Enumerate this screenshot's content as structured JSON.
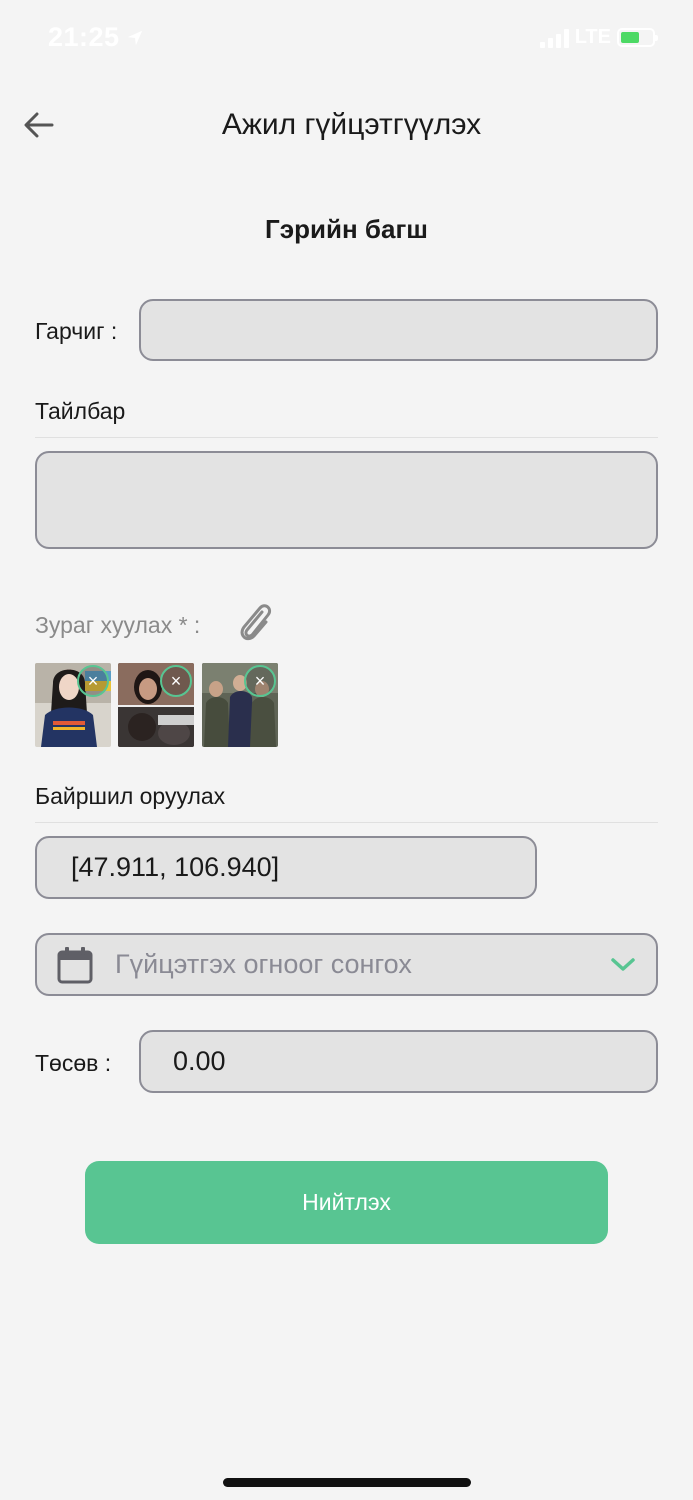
{
  "status_bar": {
    "time": "21:25",
    "network": "LTE"
  },
  "header": {
    "title": "Ажил гүйцэтгүүлэх"
  },
  "job_type": "Гэрийн багш",
  "form": {
    "title_label": "Гарчиг :",
    "title_value": "",
    "description_label": "Тайлбар",
    "description_value": "",
    "photo_label": "Зураг хуулах * :",
    "photos": [
      {
        "close_symbol": "×"
      },
      {
        "close_symbol": "×"
      },
      {
        "close_symbol": "×"
      }
    ],
    "location_label": "Байршил оруулах",
    "location_value": "[47.911, 106.940]",
    "date_placeholder": "Гүйцэтгэх огноог сонгох",
    "budget_label": "Төсөв :",
    "budget_value": "0.00",
    "submit_label": "Нийтлэх"
  },
  "colors": {
    "accent": "#58c592",
    "field_bg": "#e3e3e3",
    "field_border": "#8c8c96",
    "background": "#f4f4f4"
  },
  "icons": [
    "location-arrow-icon",
    "signal-icon",
    "battery-icon",
    "back-arrow-icon",
    "paperclip-icon",
    "close-icon",
    "calendar-icon",
    "chevron-down-icon"
  ]
}
